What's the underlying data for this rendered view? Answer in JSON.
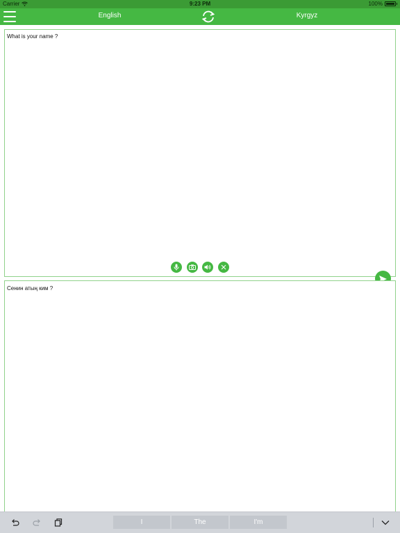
{
  "status_bar": {
    "carrier": "Carrier",
    "time": "9:23 PM",
    "battery": "100%"
  },
  "header": {
    "source_lang": "English",
    "target_lang": "Kyrgyz"
  },
  "input": {
    "text": "What is your name ?"
  },
  "output": {
    "text": "Сенин атың ким ?"
  },
  "tools": [
    "microphone-icon",
    "camera-icon",
    "speaker-icon",
    "clear-icon"
  ],
  "keyboard_bar": {
    "suggestions": [
      "I",
      "The",
      "I'm"
    ]
  },
  "colors": {
    "accent": "#45b843",
    "status_bar": "#3b9b35",
    "border": "#8fd18a",
    "keyboard_bar": "#d2d5da"
  }
}
